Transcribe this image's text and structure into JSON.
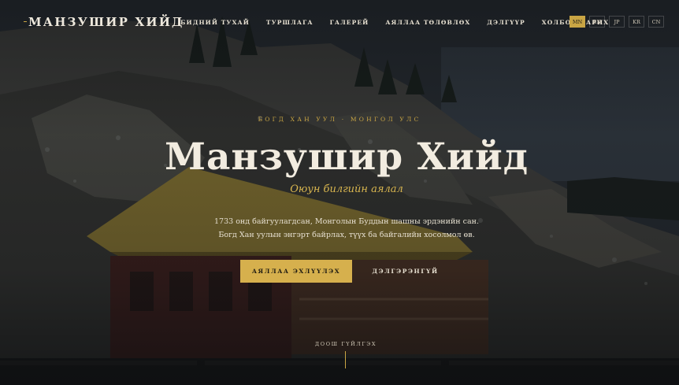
{
  "nav": {
    "brand": "МАНЗУШИР ХИЙД",
    "items": [
      {
        "label": "БИДНИЙ ТУХАЙ"
      },
      {
        "label": "ТУРШЛАГА"
      },
      {
        "label": "ГАЛЕРЕЙ"
      },
      {
        "label": "АЯЛЛАА ТӨЛӨВЛӨХ"
      },
      {
        "label": "ДЭЛГҮҮР"
      },
      {
        "label": "ХОЛБОО БАРИХ"
      }
    ],
    "languages": [
      {
        "label": "MN",
        "active": true
      },
      {
        "label": "EN",
        "active": false
      },
      {
        "label": "JP",
        "active": false
      },
      {
        "label": "KR",
        "active": false
      },
      {
        "label": "CN",
        "active": false
      }
    ]
  },
  "hero": {
    "eyebrow": "БОГД ХАН УУЛ · МОНГОЛ УЛС",
    "title": "Манзушир Хийд",
    "subtitle": "Оюун билгийн аялал",
    "description_line1": "1733 онд байгуулагдсан, Монголын Буддын шашны эрдэнийн сан.",
    "description_line2": "Богд Хан уулын энгэрт байрлах, түүх ба байгалийн хосолмол өв.",
    "primary_cta": "АЯЛЛАА ЭХЛҮҮЛЭХ",
    "secondary_cta": "ДЭЛГЭРЭНГҮЙ",
    "scroll_label": "ДООШ ГҮЙЛГЭХ"
  },
  "colors": {
    "accent": "#c9a544",
    "button": "#d6b04d",
    "text": "#f2ece0"
  }
}
